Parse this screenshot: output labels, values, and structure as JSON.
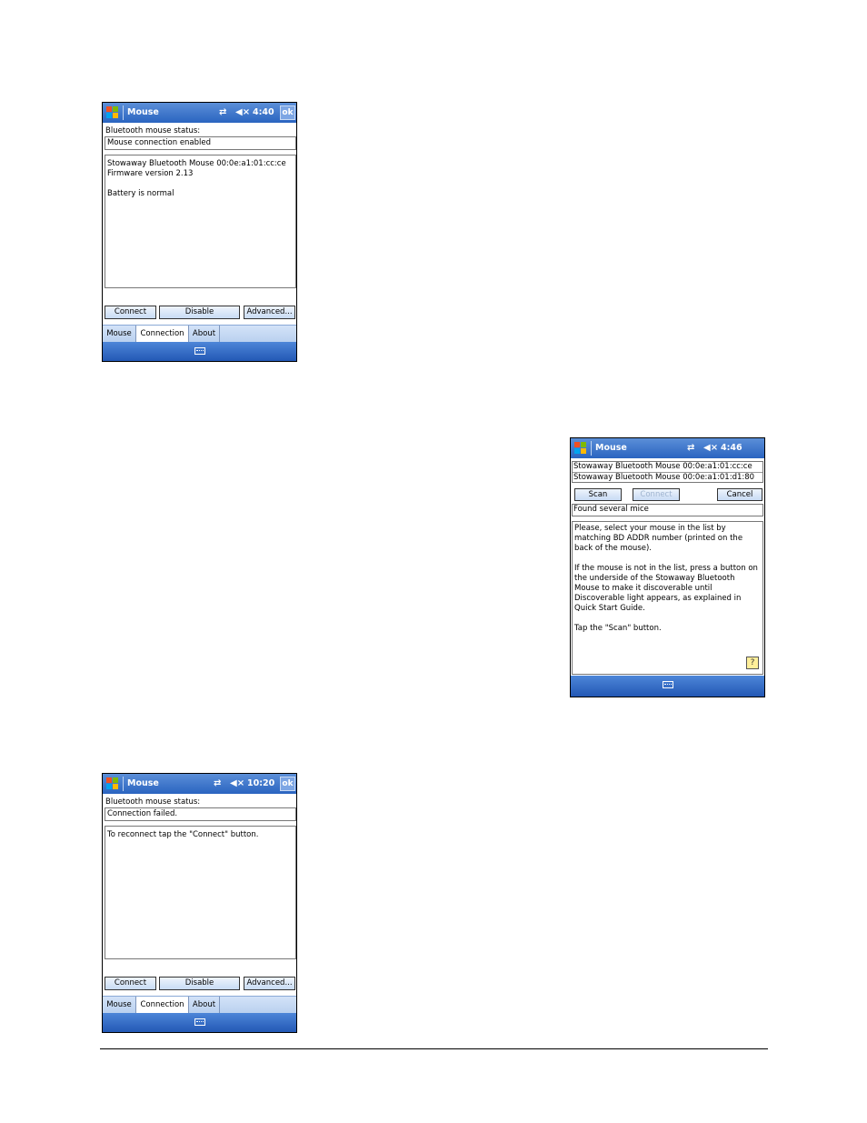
{
  "screen1": {
    "title": "Mouse",
    "clock": "4:40",
    "ok_label": "ok",
    "status_label": "Bluetooth mouse status:",
    "status_value": "Mouse connection enabled",
    "info_line1": "Stowaway Bluetooth Mouse 00:0e:a1:01:cc:ce",
    "info_line2": "Firmware version 2.13",
    "info_line3": "Battery is normal",
    "buttons": {
      "connect": "Connect",
      "disable": "Disable",
      "advanced": "Advanced..."
    },
    "tabs": [
      "Mouse",
      "Connection",
      "About"
    ]
  },
  "screen2": {
    "title": "Mouse",
    "clock": "4:46",
    "list": [
      "Stowaway Bluetooth Mouse 00:0e:a1:01:cc:ce",
      "Stowaway Bluetooth Mouse 00:0e:a1:01:d1:80"
    ],
    "buttons": {
      "scan": "Scan",
      "connect": "Connect",
      "cancel": "Cancel"
    },
    "status_value": "Found several mice",
    "help_p1": "Please, select your mouse in the list by matching BD ADDR number (printed on the back of the mouse).",
    "help_p2": "If the mouse is not in the list, press a button on the underside of the Stowaway Bluetooth Mouse to make it discoverable until Discoverable light appears, as explained in Quick Start Guide.",
    "help_p3": "Tap the \"Scan\" button.",
    "help_icon": "?"
  },
  "screen3": {
    "title": "Mouse",
    "clock": "10:20",
    "ok_label": "ok",
    "status_label": "Bluetooth mouse status:",
    "status_value": "Connection failed.",
    "info_line1": "To reconnect tap the \"Connect\" button.",
    "buttons": {
      "connect": "Connect",
      "disable": "Disable",
      "advanced": "Advanced..."
    },
    "tabs": [
      "Mouse",
      "Connection",
      "About"
    ]
  },
  "icons": [
    "windows-start-icon",
    "connectivity-icon",
    "speaker-muted-icon",
    "keyboard-icon",
    "help-icon"
  ],
  "colors": {
    "titlebar": "#2a64c0",
    "button_face": "#c8dbf4",
    "tabbar": "#b7cfee"
  }
}
